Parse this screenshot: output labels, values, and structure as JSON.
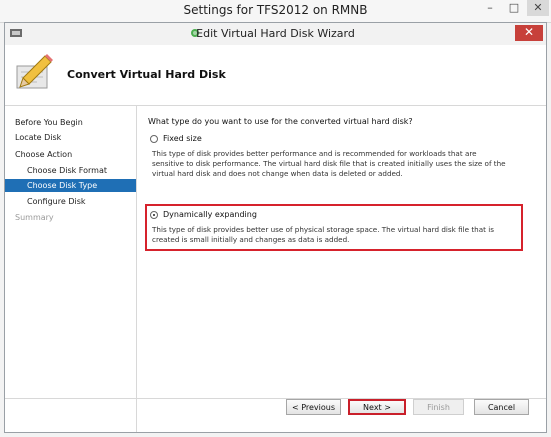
{
  "outer_window": {
    "title": "Settings for TFS2012 on RMNB",
    "buttons": [
      "–",
      "□",
      "✕"
    ]
  },
  "wizard": {
    "title": "Edit Virtual Hard Disk Wizard",
    "close": "✕",
    "header_title": "Convert Virtual Hard Disk",
    "nav": [
      {
        "label": "Before You Begin",
        "state": "normal"
      },
      {
        "label": "Locate Disk",
        "state": "normal"
      },
      {
        "label": "Choose Action",
        "state": "normal"
      },
      {
        "label": "Choose Disk Format",
        "state": "normal"
      },
      {
        "label": "Choose Disk Type",
        "state": "active"
      },
      {
        "label": "Configure Disk",
        "state": "normal"
      },
      {
        "label": "Summary",
        "state": "disabled"
      }
    ],
    "question": "What type do you want to use for the converted virtual hard disk?",
    "options": [
      {
        "label": "Fixed size",
        "selected": false,
        "description_lines": [
          "This type of disk provides better performance and is recommended for workloads that are",
          "sensitive to disk performance. The virtual hard disk file that is created initially uses the size of the",
          "virtual hard disk and does not change when data is deleted or added."
        ]
      },
      {
        "label": "Dynamically expanding",
        "selected": true,
        "description_lines": [
          "This type of disk provides better use of physical storage space. The virtual hard disk file that is",
          "created is small initially and changes as data is added."
        ]
      }
    ],
    "buttons": {
      "previous": "< Previous",
      "next": "Next >",
      "finish": "Finish",
      "cancel": "Cancel"
    },
    "colors": {
      "nav_active": "#1f6fb5",
      "highlight": "#d6222c",
      "close": "#c7403a"
    }
  }
}
